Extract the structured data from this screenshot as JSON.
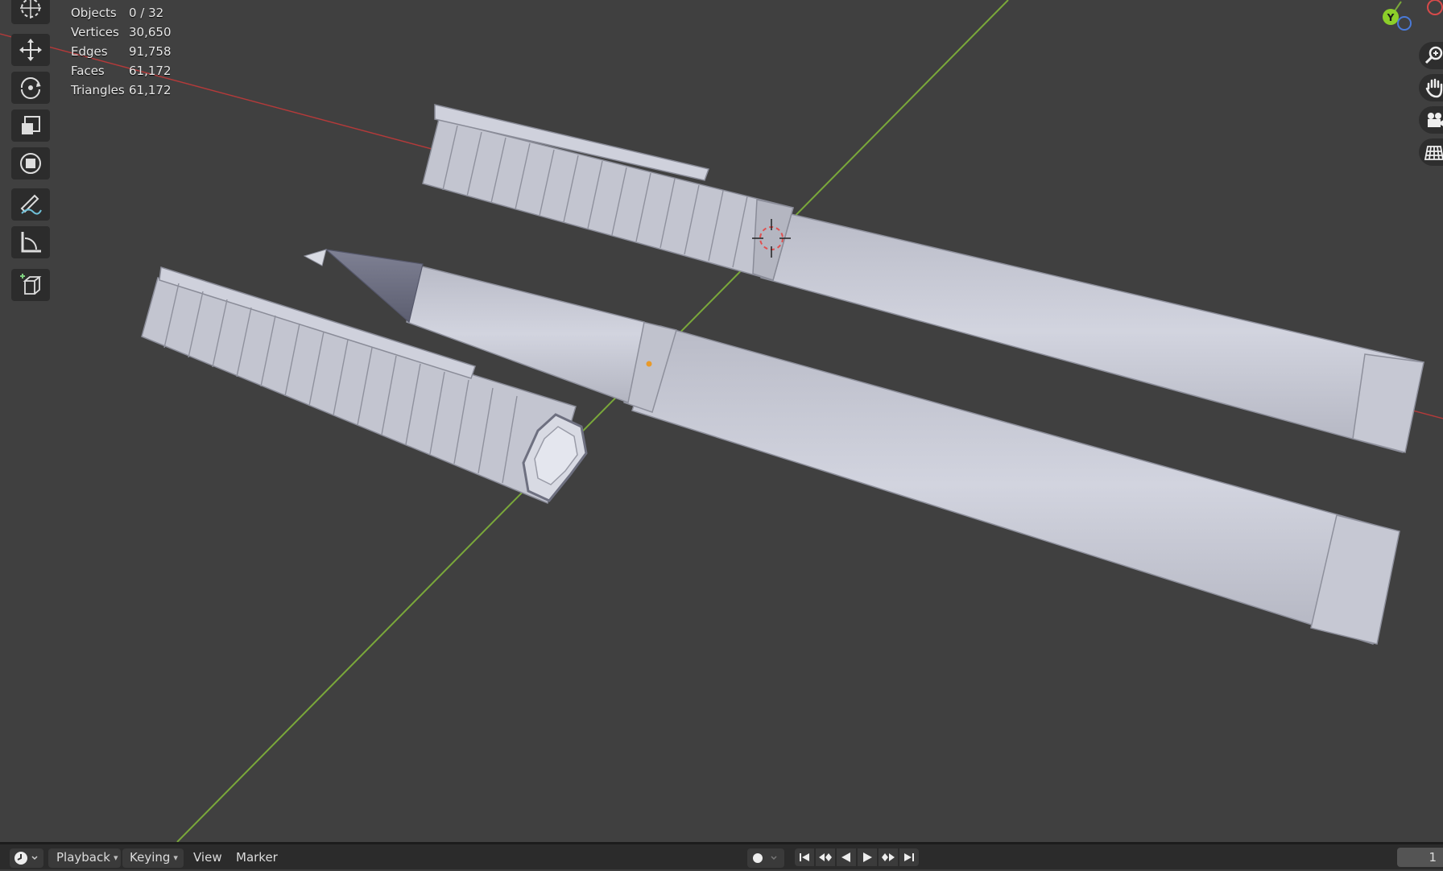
{
  "stats": [
    {
      "label": "Objects",
      "value": "0 / 32"
    },
    {
      "label": "Vertices",
      "value": "30,650"
    },
    {
      "label": "Edges",
      "value": "91,758"
    },
    {
      "label": "Faces",
      "value": "61,172"
    },
    {
      "label": "Triangles",
      "value": "61,172"
    }
  ],
  "toolbar": {
    "tools": [
      "cursor-icon",
      "move-icon",
      "rotate-icon",
      "scale-icon",
      "transform-icon",
      "annotate-icon",
      "measure-icon",
      "add-cube-icon"
    ]
  },
  "gizmo": {
    "y_label": "Y"
  },
  "navigation": [
    "zoom-icon",
    "hand-pan-icon",
    "camera-icon",
    "grid-ortho-icon"
  ],
  "timeline": {
    "menus": [
      "Playback",
      "Keying",
      "View",
      "Marker"
    ],
    "current_frame": "1"
  },
  "colors": {
    "background": "#404040",
    "x_axis": "#b43a3a",
    "y_axis": "#7aa83a",
    "model": "#c9cbd7",
    "timeline_bg": "#2b2b2b"
  }
}
